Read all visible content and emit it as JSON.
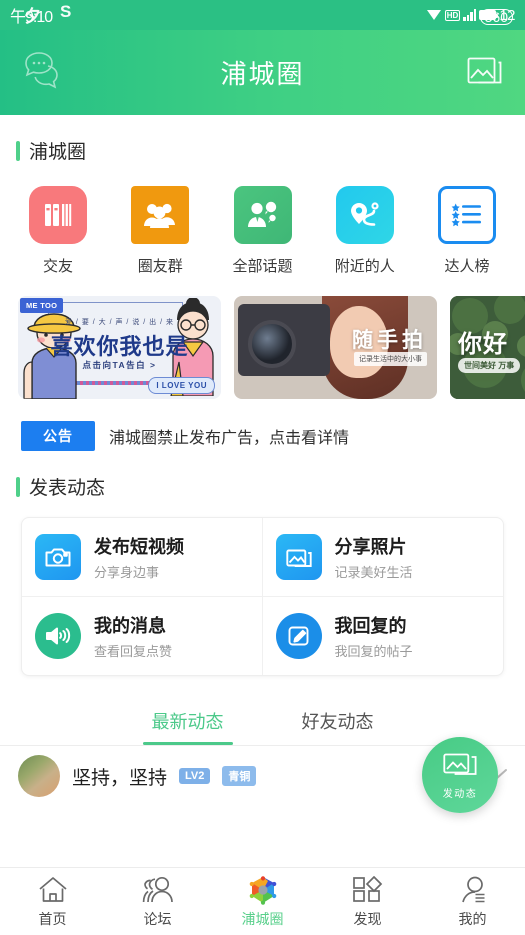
{
  "statusbar": {
    "time": "午9:10",
    "overlay_left_1": "夕",
    "overlay_left_2": "S",
    "battery_number": "12",
    "overlay_right": "360",
    "icons": [
      "wifi-icon",
      "hd-icon",
      "signal-icon",
      "battery-icon"
    ]
  },
  "header": {
    "title": "浦城圈",
    "left_icon": "chat-bubbles-icon",
    "right_icon": "gallery-icon",
    "gradient_start": "#24bf85",
    "gradient_end": "#50d781"
  },
  "section1": {
    "title": "浦城圈",
    "accent": "#4fd08a",
    "items": [
      {
        "label": "交友",
        "icon": "books-icon",
        "color": "#f8797c"
      },
      {
        "label": "圈友群",
        "icon": "group-icon",
        "color": "#f0990f"
      },
      {
        "label": "全部话题",
        "icon": "topic-icon",
        "color": "#4bc57f"
      },
      {
        "label": "附近的人",
        "icon": "location-icon",
        "color": "#22c9ee"
      },
      {
        "label": "达人榜",
        "icon": "ranklist-icon",
        "color": "#1a8cf0"
      }
    ]
  },
  "banners": [
    {
      "tag": "ME TOO",
      "sub": "爱 / 要 / 大 / 声 / 说 / 出 / 来",
      "title": "喜欢你我也是",
      "cta": "点击向TA告白 >",
      "bubble": "I LOVE YOU"
    },
    {
      "title": "随手拍",
      "tag": "记录生活中的大小事"
    },
    {
      "title": "你好",
      "tag": "世间美好 万事"
    }
  ],
  "announcement": {
    "badge": "公告",
    "badge_color": "#1c7ef0",
    "text": "浦城圈禁止发布广告，点击看详情"
  },
  "section2": {
    "title": "发表动态",
    "cells": [
      {
        "title": "发布短视频",
        "subtitle": "分享身边事",
        "icon": "camera-icon",
        "color": "#2bb8f5"
      },
      {
        "title": "分享照片",
        "subtitle": "记录美好生活",
        "icon": "photos-icon",
        "color": "#2bb8f5"
      },
      {
        "title": "我的消息",
        "subtitle": "查看回复点赞",
        "icon": "speaker-icon",
        "color": "#2bbd8e"
      },
      {
        "title": "我回复的",
        "subtitle": "我回复的帖子",
        "icon": "pencil-icon",
        "color": "#1b8ee8"
      }
    ]
  },
  "tabs": [
    {
      "label": "最新动态",
      "active": true
    },
    {
      "label": "好友动态",
      "active": false
    }
  ],
  "fab": {
    "label": "发动态",
    "icon": "gallery-icon",
    "color": "#47cb85"
  },
  "feed": [
    {
      "name": "坚持，坚持",
      "level_badge": "LV2",
      "rank_badge": "青铜",
      "chevron": "chevron-down-icon"
    }
  ],
  "bottomnav": {
    "active_color": "#5ad08c",
    "items": [
      {
        "label": "首页",
        "icon": "home-icon",
        "active": false
      },
      {
        "label": "论坛",
        "icon": "forum-icon",
        "active": false
      },
      {
        "label": "浦城圈",
        "icon": "circle-icon",
        "active": true
      },
      {
        "label": "发现",
        "icon": "discover-icon",
        "active": false
      },
      {
        "label": "我的",
        "icon": "profile-icon",
        "active": false
      }
    ]
  }
}
